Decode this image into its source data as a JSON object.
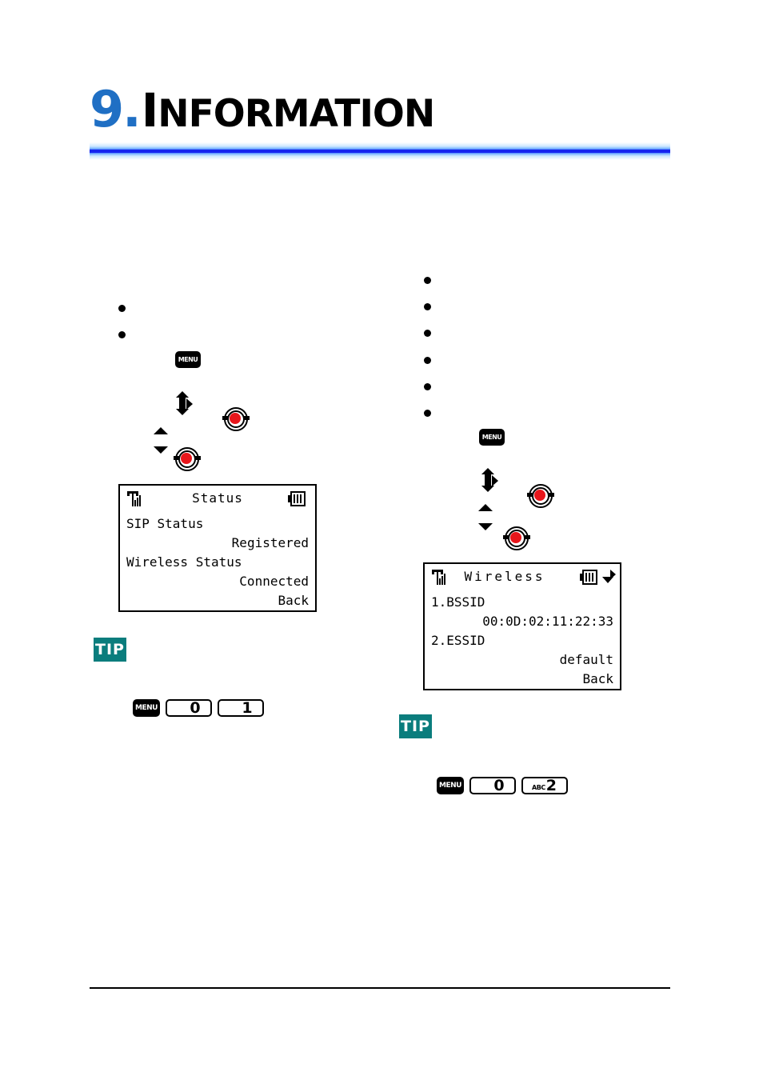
{
  "chapter": {
    "number": "9",
    "separator": ".",
    "title_cap": "I",
    "title_rest": "NFORMATION",
    "title_full": "9.INFORMATION"
  },
  "colors": {
    "chapter_number": "#1f6fc4",
    "rule_blue": "#1524ef",
    "tip_teal": "#0a7d7d",
    "ok_button_red": "#e8161b",
    "text_black": "#000000"
  },
  "left_column": {
    "bullets": [
      "",
      ""
    ],
    "keys": {
      "menu_label": "MENU"
    },
    "lcd": {
      "title": "Status",
      "signal_icon": "signal-bars-icon",
      "battery_icon": "battery-icon",
      "rows": [
        {
          "label": "SIP Status",
          "value": "Registered"
        },
        {
          "label": "Wireless Status",
          "value": "Connected"
        }
      ],
      "back_label": "Back"
    },
    "tip": {
      "badge": "TIP",
      "sequence": [
        {
          "type": "menu",
          "label": "MENU"
        },
        {
          "type": "digit",
          "label": "0"
        },
        {
          "type": "digit",
          "label": "1"
        }
      ]
    }
  },
  "right_column": {
    "bullets": [
      "",
      "",
      "",
      "",
      "",
      ""
    ],
    "keys": {
      "menu_label": "MENU"
    },
    "lcd": {
      "title": "Wireless",
      "signal_icon": "signal-bars-icon",
      "battery_icon": "battery-icon",
      "scroll_icon": "scroll-indicator-icon",
      "rows": [
        {
          "label": "1.BSSID",
          "value": "00:0D:02:11:22:33"
        },
        {
          "label": "2.ESSID",
          "value": "default"
        }
      ],
      "back_label": "Back"
    },
    "tip": {
      "badge": "TIP",
      "sequence": [
        {
          "type": "menu",
          "label": "MENU"
        },
        {
          "type": "digit",
          "label": "0"
        },
        {
          "type": "digit_alpha",
          "alpha": "ABC",
          "label": "2"
        }
      ]
    }
  }
}
